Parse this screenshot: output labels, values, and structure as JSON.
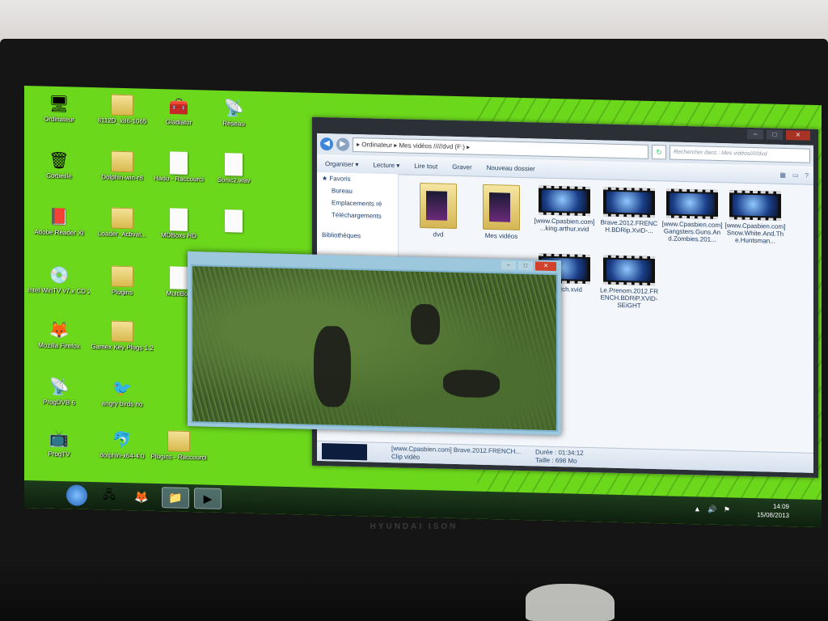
{
  "tv": {
    "brand": "HYUNDAI ISON"
  },
  "desktop": {
    "icons": [
      {
        "label": "Ordinateur",
        "glyph": "🖥"
      },
      {
        "label": "8112D_x86-1065",
        "glyph": "folder"
      },
      {
        "label": "Gladiator",
        "glyph": "🧰"
      },
      {
        "label": "Réseau",
        "glyph": "📡"
      },
      {
        "label": "Corbeille",
        "glyph": "🗑"
      },
      {
        "label": "Dolphin-win-r8",
        "glyph": "folder"
      },
      {
        "label": "Hadu - Raccourci",
        "glyph": "doc"
      },
      {
        "label": "Sonic2.wav",
        "glyph": "doc"
      },
      {
        "label": "Adobe Reader XI",
        "glyph": "📕"
      },
      {
        "label": "Loader_Activat...",
        "glyph": "folder"
      },
      {
        "label": "MDBoxs HD",
        "glyph": "doc"
      },
      {
        "label": "",
        "glyph": "doc"
      },
      {
        "label": "Intel WinTV v7.x CD 27",
        "glyph": "💿"
      },
      {
        "label": "Plugins",
        "glyph": "folder"
      },
      {
        "label": "MultiBox",
        "glyph": "doc"
      },
      {
        "label": "Mozilla Firefox",
        "glyph": "🦊"
      },
      {
        "label": "Gamex Key Plugs 1.2",
        "glyph": "folder"
      },
      {
        "label": "ProgDVB 6",
        "glyph": "📡"
      },
      {
        "label": "angry birds rio",
        "glyph": "🐦"
      },
      {
        "label": "ProgTV",
        "glyph": "📺"
      },
      {
        "label": "dolphin-x64-4.0",
        "glyph": "🐬"
      },
      {
        "label": "Plugins - Raccourci",
        "glyph": "folder"
      }
    ]
  },
  "explorer": {
    "path": "▸ Ordinateur ▸ Mes vidéos /////dvd (F:) ▸",
    "search_placeholder": "Rechercher dans : Mes vidéos/////dvd",
    "toolbar": [
      "Organiser ▾",
      "Lecture ▾",
      "Lire tout",
      "Graver",
      "Nouveau dossier"
    ],
    "nav": [
      {
        "label": "Favoris",
        "sub": false
      },
      {
        "label": "Bureau",
        "sub": true
      },
      {
        "label": "Emplacements ré",
        "sub": true
      },
      {
        "label": "Téléchargements",
        "sub": true
      },
      {
        "label": "Bibliothèques",
        "sub": false
      }
    ],
    "items": [
      {
        "caption": "dvd",
        "kind": "folder"
      },
      {
        "caption": "Mes vidéos",
        "kind": "folder"
      },
      {
        "caption": "[www.Cpasbien.com] ...king.arthur.xvid",
        "kind": "video"
      },
      {
        "caption": "Brave.2012.FRENCH.BDRip.XviD-...",
        "kind": "video"
      },
      {
        "caption": "[www.Cpasbien.com] Gangsters.Guns.And.Zombies.201...",
        "kind": "video"
      },
      {
        "caption": "[www.Cpasbien.com] Snow.White.And.The.Huntsman...",
        "kind": "video"
      },
      {
        "caption": "...watch.xvid",
        "kind": "video"
      },
      {
        "caption": "Le.Prenom.2012.FRENCH.BDRiP.XViD-SEiGHT",
        "kind": "video"
      }
    ],
    "details": {
      "name": "[www.Cpasbien.com] Brave.2012.FRENCH...",
      "type": "Clip vidéo",
      "duration_label": "Durée : 01:34:12",
      "size_label": "Taille : 698 Mo"
    }
  },
  "taskbar": {
    "time": "14:09",
    "date": "15/08/2013"
  }
}
